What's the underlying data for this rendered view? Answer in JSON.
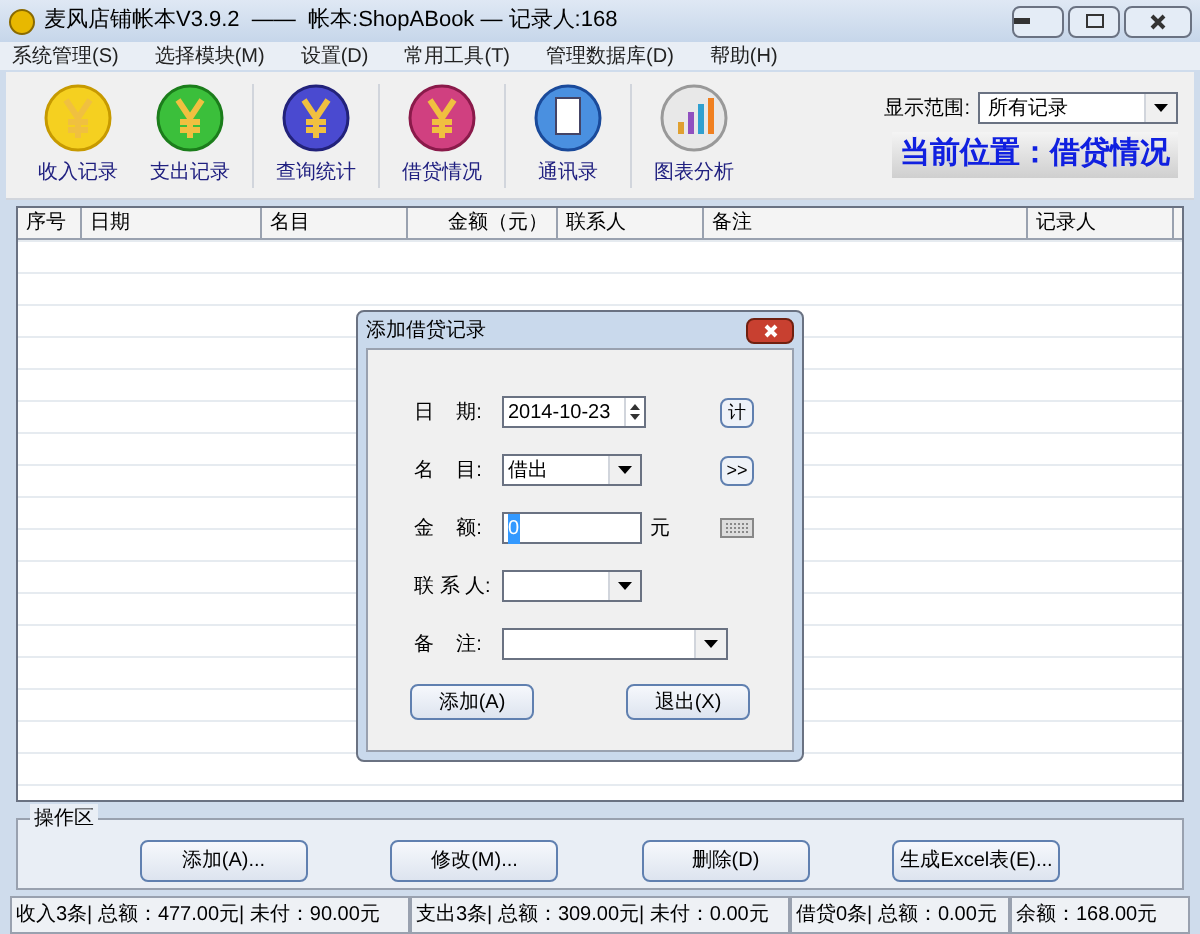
{
  "window": {
    "title": "麦风店铺帐本V3.9.2  ——  帐本:ShopABook — 记录人:168"
  },
  "menu": [
    "系统管理(S)",
    "选择模块(M)",
    "设置(D)",
    "常用工具(T)",
    "管理数据库(D)",
    "帮助(H)"
  ],
  "toolbar": [
    {
      "label": "收入记录",
      "kind": "income"
    },
    {
      "label": "支出记录",
      "kind": "expense"
    },
    {
      "label": "查询统计",
      "kind": "query"
    },
    {
      "label": "借贷情况",
      "kind": "loan"
    },
    {
      "label": "通讯录",
      "kind": "contacts"
    },
    {
      "label": "图表分析",
      "kind": "chart"
    }
  ],
  "range": {
    "label": "显示范围:",
    "value": "所有记录"
  },
  "location": "当前位置：借贷情况",
  "table": {
    "columns": [
      "序号",
      "日期",
      "名目",
      "金额（元）",
      "联系人",
      "备注",
      "记录人"
    ]
  },
  "dialog": {
    "title": "添加借贷记录",
    "fields": [
      {
        "label": "日    期:",
        "kind": "date",
        "value": "2014-10-23",
        "side": "计"
      },
      {
        "label": "名    目:",
        "kind": "select",
        "value": "借出",
        "side": ">>"
      },
      {
        "label": "金    额:",
        "kind": "amount",
        "value": "0",
        "unit": "元"
      },
      {
        "label": "联 系 人:",
        "kind": "select"
      },
      {
        "label": "备    注:",
        "kind": "wide"
      }
    ],
    "buttons": [
      "添加(A)",
      "退出(X)"
    ]
  },
  "operations": {
    "title": "操作区",
    "buttons": [
      "添加(A)...",
      "修改(M)...",
      "删除(D)",
      "生成Excel表(E)..."
    ]
  },
  "status_bar": [
    "收入3条| 总额：477.00元| 未付：90.00元",
    "支出3条| 总额：309.00元| 未付：0.00元",
    "借贷0条| 总额：0.00元",
    "余额：168.00元"
  ]
}
